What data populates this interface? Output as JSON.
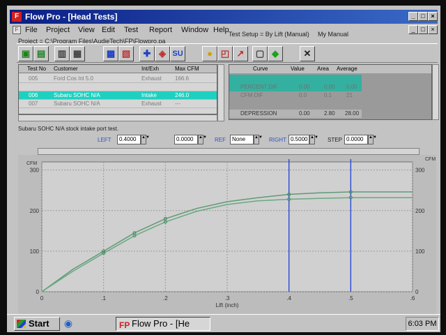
{
  "window": {
    "title": "Flow Pro - [Head Tests]",
    "icon": "fp-app-icon",
    "controls": {
      "minimize": "_",
      "maximize": "□",
      "close": "×"
    }
  },
  "menu": {
    "items": [
      "File",
      "Project",
      "View",
      "Edit",
      "Test",
      "Report",
      "Window",
      "Help"
    ],
    "test_setup": "Test Setup = By Lift (Manual)",
    "manual": "My Manual"
  },
  "project": {
    "path": "Project = C:\\Program Files\\AudieTech\\FP\\Flowpro.pa"
  },
  "left_table": {
    "headers": [
      "Test No",
      "Customer",
      "Int/Exh",
      "Max CFM"
    ],
    "rows": [
      {
        "test_no": "005",
        "customer": "Ford Cos Inl 5.0",
        "int_exh": "Exhaust",
        "max_cfm": "166.6"
      },
      {
        "test_no": "",
        "customer": "",
        "int_exh": "",
        "max_cfm": ""
      },
      {
        "test_no": "006",
        "customer": "Subaru SOHC N/A",
        "int_exh": "Intake",
        "max_cfm": "246.0"
      },
      {
        "test_no": "007",
        "customer": "Subaru SOHC N/A",
        "int_exh": "Exhaust",
        "max_cfm": "---"
      }
    ],
    "selected_index": 2
  },
  "right_table": {
    "headers": [
      "Curve",
      "Value",
      "Area",
      "Average"
    ],
    "rows": [
      {
        "curve": "",
        "value": "",
        "area": "",
        "average": ""
      },
      {
        "curve": "PERCENT DIF",
        "value": "0.00",
        "area": "0.00",
        "average": "0.00"
      },
      {
        "curve": "CFM DIF",
        "value": "0.0",
        "area": "0.1",
        "average": "21"
      },
      {
        "curve": "",
        "value": "",
        "area": "",
        "average": ""
      },
      {
        "curve": "DEPRESSION",
        "value": "0.00",
        "area": "2.80",
        "average": "28.00"
      }
    ]
  },
  "description": "Subaru SOHC N/A stock intake port test.",
  "params": {
    "left_label": "LEFT",
    "left_value": "0.4000",
    "mid_value": "0.0000",
    "ref_label": "REF",
    "ref_value": "None",
    "right_label": "RIGHT",
    "right_value": "0.5000",
    "step_label": "STEP",
    "step_value": "0.0000"
  },
  "chart_data": {
    "type": "line",
    "xlabel": "Lift (inch)",
    "ylabel": "CFM",
    "ylabel_right": "CFM",
    "xlim": [
      0,
      0.6
    ],
    "ylim": [
      0,
      320
    ],
    "yticks": [
      0,
      100,
      200,
      300
    ],
    "yticks_right": [
      0,
      100,
      200,
      300
    ],
    "xticks": [
      0,
      0.1,
      0.2,
      0.3,
      0.4,
      0.5,
      0.6
    ],
    "xtick_labels": [
      "0",
      ".1",
      ".2",
      ".3",
      ".4",
      ".5",
      ".6"
    ],
    "grid": true,
    "vertical_markers": [
      0.4,
      0.5
    ],
    "series": [
      {
        "color": "#5f9a74",
        "x": [
          0,
          0.05,
          0.1,
          0.15,
          0.2,
          0.25,
          0.3,
          0.35,
          0.4,
          0.45,
          0.5,
          0.55,
          0.6
        ],
        "y": [
          0,
          55,
          100,
          145,
          180,
          205,
          222,
          232,
          240,
          244,
          246,
          246,
          246
        ]
      },
      {
        "color": "#6aa883",
        "x": [
          0,
          0.05,
          0.1,
          0.15,
          0.2,
          0.25,
          0.3,
          0.35,
          0.4,
          0.45,
          0.5,
          0.55,
          0.6
        ],
        "y": [
          0,
          50,
          95,
          138,
          172,
          198,
          215,
          224,
          228,
          230,
          232,
          232,
          232
        ]
      }
    ],
    "marker_points": [
      {
        "x": 0.1,
        "y": 100
      },
      {
        "x": 0.15,
        "y": 145
      },
      {
        "x": 0.2,
        "y": 180
      },
      {
        "x": 0.1,
        "y": 95
      },
      {
        "x": 0.15,
        "y": 138
      },
      {
        "x": 0.2,
        "y": 172
      },
      {
        "x": 0.4,
        "y": 240
      },
      {
        "x": 0.5,
        "y": 246
      },
      {
        "x": 0.4,
        "y": 228
      },
      {
        "x": 0.5,
        "y": 232
      }
    ]
  },
  "taskbar": {
    "start": "Start",
    "task": "Flow Pro - [He",
    "task_icon": "FP",
    "clock": "6:03 PM"
  }
}
